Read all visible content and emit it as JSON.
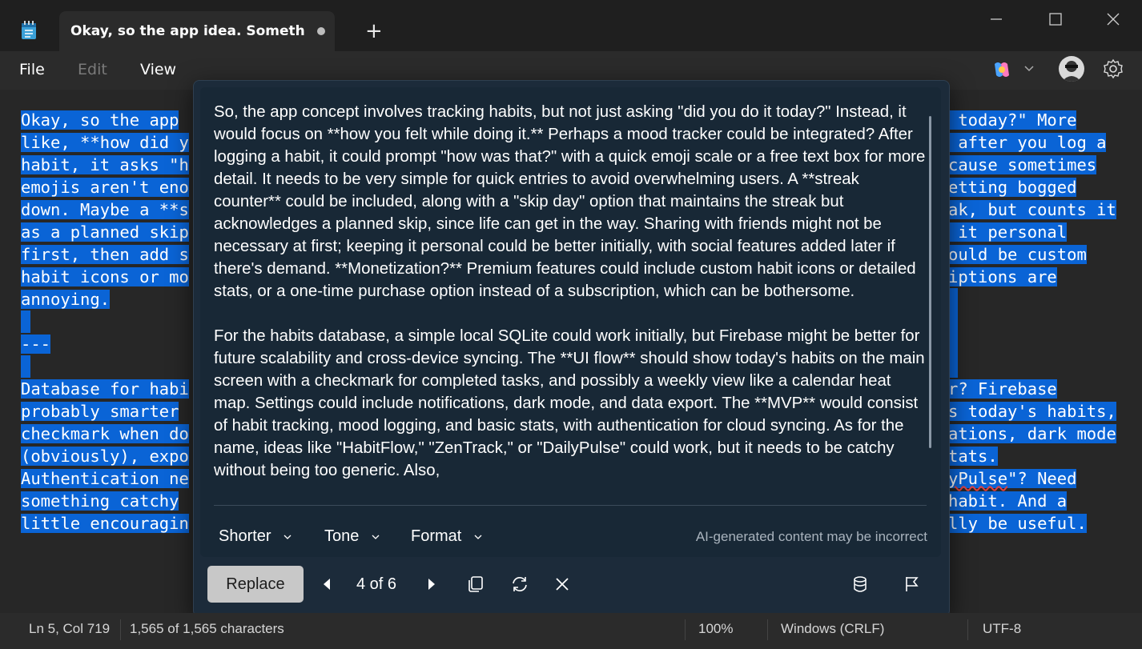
{
  "window": {
    "tab_title": "Okay, so the app idea. Something a",
    "new_tab": "+"
  },
  "menu": {
    "file": "File",
    "edit": "Edit",
    "view": "View"
  },
  "editor": {
    "lines_left": [
      "Okay, so the app",
      "like, **how did y",
      "habit, it asks \"h",
      "emojis aren't eno",
      "down. Maybe a **s",
      "as a planned skip",
      "first, then add s",
      "habit icons or mo",
      "annoying.",
      "",
      "---",
      "",
      "Database for habi",
      "probably smarter",
      "checkmark when do",
      "(obviously), expo",
      "Authentication ne",
      "something catchy",
      "little encouragin"
    ],
    "lines_right": [
      " today?\" More",
      " after you log a",
      "cause sometimes",
      "etting bogged",
      "ak, but counts it",
      " it personal",
      "ould be custom",
      "iptions are",
      "",
      "",
      "",
      "",
      "r? Firebase",
      "s today's habits,",
      "ations, dark mode",
      "tats.",
      "yPulse\"? Need",
      "habit. And a",
      "lly be useful."
    ]
  },
  "rewrite_panel": {
    "paragraphs": [
      "So, the app concept involves tracking habits, but not just asking \"did you do it today?\" Instead, it would focus on **how you felt while doing it.** Perhaps a mood tracker could be integrated? After logging a habit, it could prompt \"how was that?\" with a quick emoji scale or a free text box for more detail. It needs to be very simple for quick entries to avoid overwhelming users. A **streak counter** could be included, along with a \"skip day\" option that maintains the streak but acknowledges a planned skip, since life can get in the way. Sharing with friends might not be necessary at first; keeping it personal could be better initially, with social features added later if there's demand. **Monetization?** Premium features could include custom habit icons or detailed stats, or a one-time purchase option instead of a subscription, which can be bothersome.",
      "For the habits database, a simple local SQLite could work initially, but Firebase might be better for future scalability and cross-device syncing. The **UI flow** should show today's habits on the main screen with a checkmark for completed tasks, and possibly a weekly view like a calendar heat map. Settings could include notifications, dark mode, and data export. The **MVP** would consist of habit tracking, mood logging, and basic stats, with authentication for cloud syncing. As for the name, ideas like \"HabitFlow,\" \"ZenTrack,\" or \"DailyPulse\" could work, but it needs to be catchy without being too generic. Also,"
    ],
    "options": {
      "shorter": "Shorter",
      "tone": "Tone",
      "format": "Format"
    },
    "disclaimer": "AI-generated content may be incorrect",
    "replace_label": "Replace",
    "pager": "4 of 6"
  },
  "status": {
    "position": "Ln 5, Col 719",
    "characters": "1,565 of 1,565 characters",
    "zoom": "100%",
    "line_ending": "Windows (CRLF)",
    "encoding": "UTF-8"
  },
  "colors": {
    "selection": "#0a64d6",
    "panel_bg": "#182836"
  }
}
